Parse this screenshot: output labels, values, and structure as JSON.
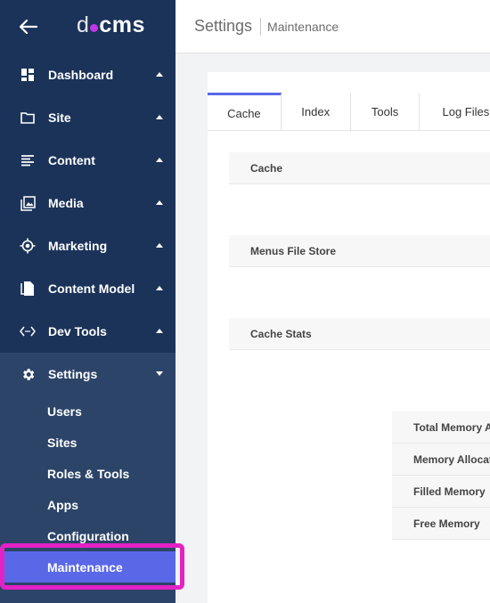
{
  "app": {
    "logo_left": "d",
    "logo_right": "cms"
  },
  "sidebar": {
    "items": [
      {
        "label": "Dashboard",
        "icon": "dashboard-icon"
      },
      {
        "label": "Site",
        "icon": "folder-icon"
      },
      {
        "label": "Content",
        "icon": "list-icon"
      },
      {
        "label": "Media",
        "icon": "image-icon"
      },
      {
        "label": "Marketing",
        "icon": "target-icon"
      },
      {
        "label": "Content Model",
        "icon": "file-copy-icon"
      },
      {
        "label": "Dev Tools",
        "icon": "code-icon"
      },
      {
        "label": "Settings",
        "icon": "gear-icon"
      }
    ],
    "settings_sub": [
      "Users",
      "Sites",
      "Roles & Tools",
      "Apps",
      "Configuration",
      "Maintenance"
    ],
    "active_sub": "Maintenance"
  },
  "header": {
    "title": "Settings",
    "breadcrumb": "Maintenance"
  },
  "tabs": [
    "Cache",
    "Index",
    "Tools",
    "Log Files"
  ],
  "sections": {
    "cache": "Cache",
    "menus": "Menus File Store",
    "stats": "Cache Stats"
  },
  "stats_rows": [
    "Total Memory Available",
    "Memory Allocated",
    "Filled Memory",
    "Free Memory"
  ],
  "colors": {
    "sidebar": "#1b3359",
    "accent": "#5a68e8",
    "highlight": "#e322c6",
    "logo_dot": "#c336e5"
  }
}
